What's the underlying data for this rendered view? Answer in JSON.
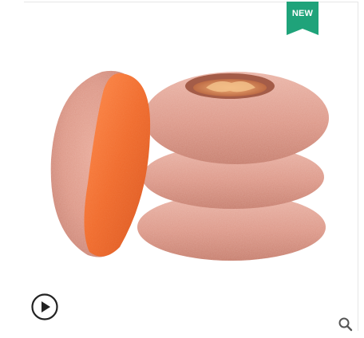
{
  "product_image": {
    "subject": "dried-persimmon-icon",
    "badge": {
      "label": "NEW",
      "color": "#1fa37a"
    }
  },
  "controls": {
    "play": {
      "icon": "play-icon",
      "color": "#222222"
    },
    "zoom": {
      "icon": "search-icon",
      "color": "#555555"
    }
  }
}
